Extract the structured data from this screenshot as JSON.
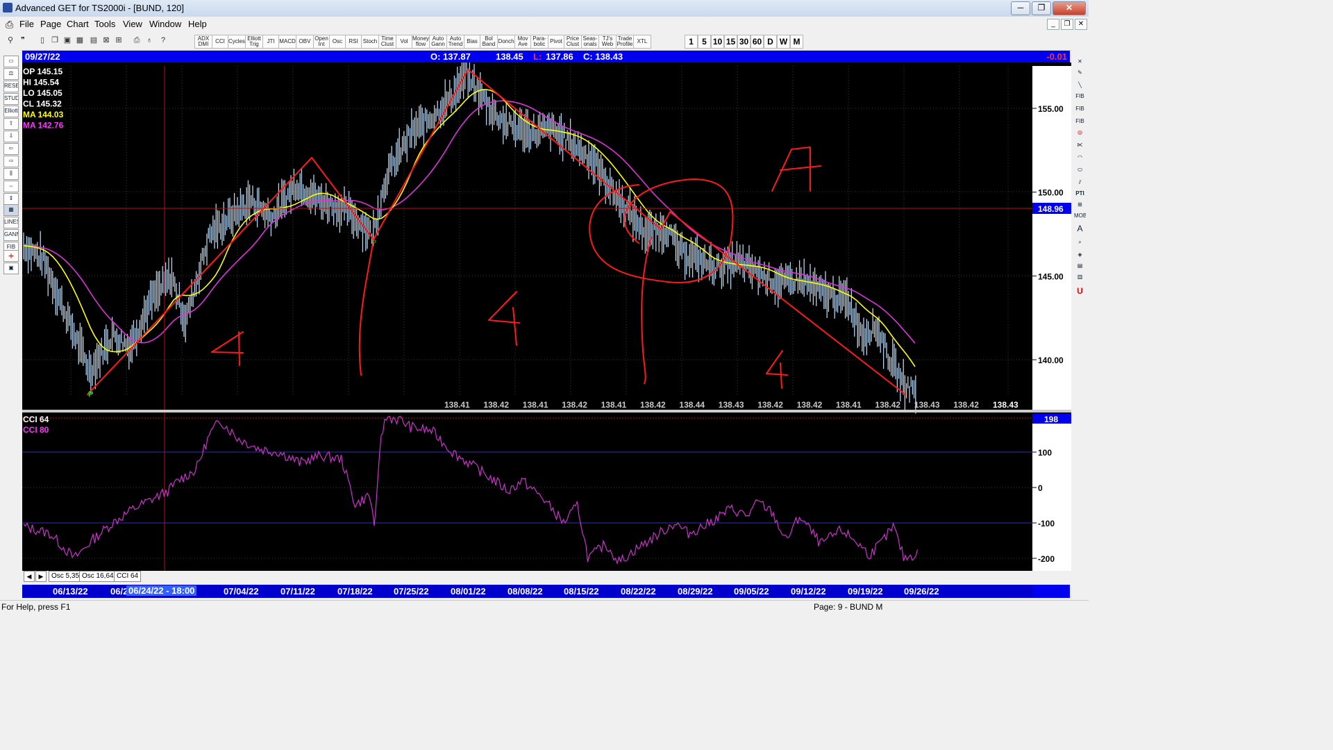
{
  "window": {
    "title": "Advanced GET for TS2000i - [BUND, 120]",
    "minimize": "─",
    "maximize": "❐",
    "close": "✕"
  },
  "menu": [
    "File",
    "Page",
    "Chart",
    "Tools",
    "View",
    "Window",
    "Help"
  ],
  "toolbar": {
    "indicators": [
      "ADX DMI",
      "CCI",
      "Cycles",
      "Elliott Trig",
      "JTI",
      "MACD",
      "OBV",
      "Open Int",
      "Osc",
      "RSI",
      "Stoch",
      "Time Clust",
      "Vol",
      "Money flow",
      "Auto Gann",
      "Auto Trend",
      "Bias",
      "Bol Band",
      "Donch",
      "Mov Ave",
      "Para-bolic",
      "Pivot",
      "Price Clust",
      "Seas-onals",
      "TJ's Web",
      "Trade Profile",
      "XTL"
    ],
    "periods": [
      "1",
      "5",
      "10",
      "15",
      "30",
      "60",
      "D",
      "W",
      "M"
    ]
  },
  "info_bar": {
    "date": "09/27/22",
    "open": "O: 137.87",
    "high": "138.45",
    "low_label": "L:",
    "low": "137.86",
    "close": "C: 138.43",
    "change": "-0.01"
  },
  "price_panel": {
    "readouts": [
      {
        "label": "OP",
        "value": "145.15",
        "color": "#ffffff"
      },
      {
        "label": "HI",
        "value": "145.54",
        "color": "#ffffff"
      },
      {
        "label": "LO",
        "value": "145.05",
        "color": "#ffffff"
      },
      {
        "label": "CL",
        "value": "145.32",
        "color": "#ffffff"
      },
      {
        "label": "MA",
        "value": "144.03",
        "color": "#ffff00"
      },
      {
        "label": "MA",
        "value": "142.76",
        "color": "#ff33ff"
      }
    ],
    "y_ticks": [
      "155.00",
      "150.00",
      "145.00",
      "140.00"
    ],
    "cursor_price": "148.96",
    "bottom_prices": [
      "138.41",
      "138.42",
      "138.41",
      "138.42",
      "138.41",
      "138.42",
      "138.44",
      "138.43",
      "138.42",
      "138.42",
      "138.41",
      "138.42",
      "138.43",
      "138.42"
    ],
    "last_price": "138.43",
    "pivot_label": "P",
    "pivot_label_2": "P"
  },
  "annotations": {
    "big_A": "A",
    "fours": [
      "4",
      "4",
      "4"
    ]
  },
  "osc_panel": {
    "labels": [
      {
        "text": "CCI 64",
        "color": "#ffffff"
      },
      {
        "text": "CCI  80",
        "color": "#ff33ff"
      }
    ],
    "y_ticks": [
      "100",
      "0",
      "-100",
      "-200"
    ],
    "current_value": "198"
  },
  "tabs": [
    "Osc 5,35",
    "Osc 16,64",
    "CCI 64"
  ],
  "date_axis": {
    "labels": [
      "06/13/22",
      "06/2",
      "07/04/22",
      "07/11/22",
      "07/18/22",
      "07/25/22",
      "08/01/22",
      "08/08/22",
      "08/15/22",
      "08/22/22",
      "08/29/22",
      "09/05/22",
      "09/12/22",
      "09/19/22",
      "09/26/22"
    ],
    "cursor_label": "06/24/22 - 18:00"
  },
  "status": {
    "left": "For Help, press F1",
    "right": "Page: 9 - BUND M"
  },
  "colors": {
    "chart_bg": "#000000",
    "bars": "#b8d4ee",
    "ma_fast": "#ffff00",
    "ma_slow": "#dd33dd",
    "annotation": "#ff1a1a",
    "info_bar": "#0000ee",
    "cursor_price_box": "#0000ee"
  }
}
